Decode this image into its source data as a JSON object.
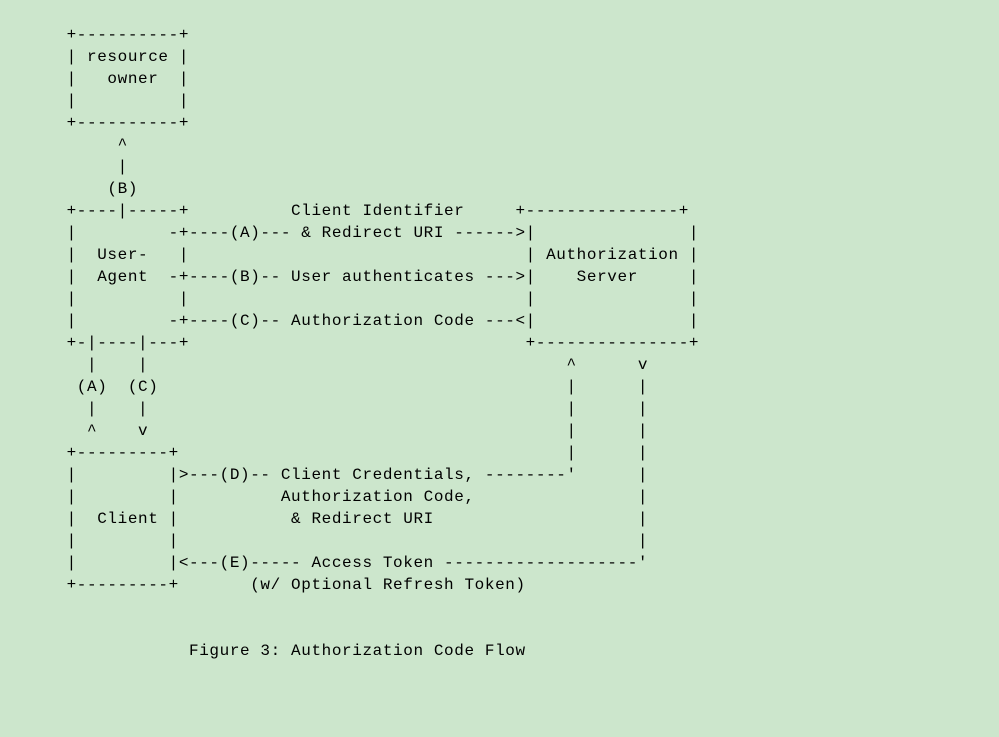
{
  "diagram": {
    "entities": {
      "resource_owner": "resource\nowner",
      "user_agent": "User-\nAgent",
      "authorization_server": "Authorization\nServer",
      "client": "Client"
    },
    "flows": {
      "A": "Client Identifier & Redirect URI",
      "B_up": "(B)",
      "B": "User authenticates",
      "C": "Authorization Code",
      "D": "Client Credentials, Authorization Code, & Redirect URI",
      "E": "Access Token (w/ Optional Refresh Token)"
    },
    "caption": "Figure 3: Authorization Code Flow",
    "ascii": "   +----------+\n   | resource |\n   |   owner  |\n   |          |\n   +----------+\n        ^\n        |\n       (B)\n   +----|-----+          Client Identifier     +---------------+\n   |         -+----(A)--- & Redirect URI ------>|               |\n   |  User-   |                                 | Authorization |\n   |  Agent  -+----(B)-- User authenticates --->|    Server     |\n   |          |                                 |               |\n   |         -+----(C)-- Authorization Code ---<|               |\n   +-|----|---+                                 +---------------+\n     |    |                                         ^      v\n    (A)  (C)                                        |      |\n     |    |                                         |      |\n     ^    v                                         |      |\n   +---------+                                      |      |\n   |         |>---(D)-- Client Credentials, --------'      |\n   |         |          Authorization Code,                |\n   |  Client |           & Redirect URI                    |\n   |         |                                             |\n   |         |<---(E)----- Access Token -------------------'\n   +---------+       (w/ Optional Refresh Token)\n\n\n               Figure 3: Authorization Code Flow"
  }
}
